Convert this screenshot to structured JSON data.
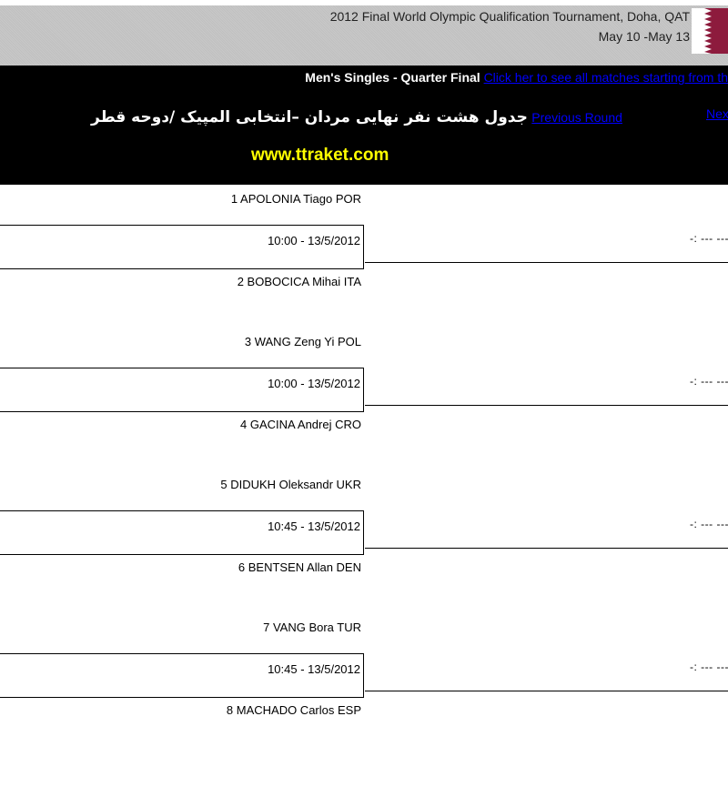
{
  "header": {
    "tournament_title": "2012 Final World Olympic Qualification Tournament, Doha, QAT",
    "dates": "May 10 -May 13",
    "flag_icon": "qatar-flag-icon",
    "flag_colors": {
      "white": "#ffffff",
      "maroon": "#8d1b3d"
    }
  },
  "banner": {
    "round_title": "Men's Singles - Quarter Final",
    "all_matches_link": "Click her to see all matches starting from th",
    "persian_title": "جدول هشت نفر نهایی مردان –انتخابی المپیک /دوحه قطر",
    "previous_round_link": "Previous Round ",
    "next_round_link": "Nex",
    "website": "www.ttraket.com",
    "colors": {
      "background": "#000000",
      "title": "#ffffff",
      "link": "#0000ff",
      "website": "#ffff00"
    }
  },
  "matches": [
    {
      "player_top": "1 APOLONIA Tiago POR",
      "player_bottom": "2 BOBOCICA Mihai ITA",
      "time": "10:00 - 13/5/2012",
      "score": "-: --- ---"
    },
    {
      "player_top": "3 WANG Zeng Yi POL",
      "player_bottom": "4 GACINA Andrej CRO",
      "time": "10:00 - 13/5/2012",
      "score": "-: --- ---"
    },
    {
      "player_top": "5 DIDUKH Oleksandr UKR",
      "player_bottom": "6 BENTSEN Allan DEN",
      "time": "10:45 - 13/5/2012",
      "score": "-: --- ---"
    },
    {
      "player_top": "7 VANG Bora TUR",
      "player_bottom": "8 MACHADO Carlos ESP",
      "time": "10:45 - 13/5/2012",
      "score": "-: --- ---"
    }
  ]
}
